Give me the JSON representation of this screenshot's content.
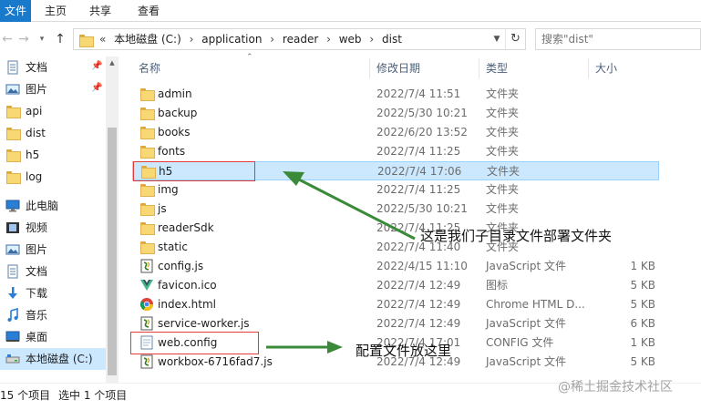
{
  "ribbon": {
    "tabs": [
      "文件",
      "主页",
      "共享",
      "查看"
    ]
  },
  "navigation": {
    "back_icon": "arrow-left-icon",
    "forward_icon": "arrow-right-icon",
    "history_icon": "chevron-down-icon",
    "up_icon": "arrow-up-icon",
    "breadcrumb_overflow": "«",
    "breadcrumb": [
      "本地磁盘 (C:)",
      "application",
      "reader",
      "web",
      "dist"
    ],
    "separator": "›"
  },
  "search": {
    "placeholder": "搜索\"dist\""
  },
  "sidebar": {
    "items": [
      {
        "label": "文档",
        "icon": "documents-icon",
        "pinned": true
      },
      {
        "label": "图片",
        "icon": "pictures-icon",
        "pinned": true
      },
      {
        "label": "api",
        "icon": "folder-icon",
        "pinned": false
      },
      {
        "label": "dist",
        "icon": "folder-icon",
        "pinned": false
      },
      {
        "label": "h5",
        "icon": "folder-icon",
        "pinned": false
      },
      {
        "label": "log",
        "icon": "folder-icon",
        "pinned": false
      },
      {
        "label": "此电脑",
        "icon": "computer-icon",
        "pinned": false
      },
      {
        "label": "视频",
        "icon": "videos-icon",
        "pinned": false
      },
      {
        "label": "图片",
        "icon": "pictures-icon",
        "pinned": false
      },
      {
        "label": "文档",
        "icon": "documents-icon",
        "pinned": false
      },
      {
        "label": "下载",
        "icon": "downloads-icon",
        "pinned": false
      },
      {
        "label": "音乐",
        "icon": "music-icon",
        "pinned": false
      },
      {
        "label": "桌面",
        "icon": "desktop-icon",
        "pinned": false
      },
      {
        "label": "本地磁盘 (C:)",
        "icon": "drive-icon",
        "pinned": false,
        "selected": true
      }
    ]
  },
  "columns": {
    "name": "名称",
    "date": "修改日期",
    "type": "类型",
    "size": "大小"
  },
  "files": [
    {
      "name": "admin",
      "date": "2022/7/4 11:51",
      "type": "文件夹",
      "size": "",
      "icon": "folder-icon"
    },
    {
      "name": "backup",
      "date": "2022/5/30 10:21",
      "type": "文件夹",
      "size": "",
      "icon": "folder-icon"
    },
    {
      "name": "books",
      "date": "2022/6/20 13:52",
      "type": "文件夹",
      "size": "",
      "icon": "folder-icon"
    },
    {
      "name": "fonts",
      "date": "2022/7/4 11:25",
      "type": "文件夹",
      "size": "",
      "icon": "folder-icon"
    },
    {
      "name": "h5",
      "date": "2022/7/4 17:06",
      "type": "文件夹",
      "size": "",
      "icon": "folder-icon",
      "selected": true
    },
    {
      "name": "img",
      "date": "2022/7/4 11:25",
      "type": "文件夹",
      "size": "",
      "icon": "folder-icon"
    },
    {
      "name": "js",
      "date": "2022/5/30 10:21",
      "type": "文件夹",
      "size": "",
      "icon": "folder-icon"
    },
    {
      "name": "readerSdk",
      "date": "2022/7/4 11:25",
      "type": "文件夹",
      "size": "",
      "icon": "folder-icon"
    },
    {
      "name": "static",
      "date": "2022/7/4 11:40",
      "type": "文件夹",
      "size": "",
      "icon": "folder-icon"
    },
    {
      "name": "config.js",
      "date": "2022/4/15 11:10",
      "type": "JavaScript 文件",
      "size": "1 KB",
      "icon": "javascript-file-icon"
    },
    {
      "name": "favicon.ico",
      "date": "2022/7/4 12:49",
      "type": "图标",
      "size": "5 KB",
      "icon": "vue-icon"
    },
    {
      "name": "index.html",
      "date": "2022/7/4 12:49",
      "type": "Chrome HTML D...",
      "size": "5 KB",
      "icon": "chrome-icon"
    },
    {
      "name": "service-worker.js",
      "date": "2022/7/4 12:49",
      "type": "JavaScript 文件",
      "size": "6 KB",
      "icon": "javascript-file-icon"
    },
    {
      "name": "web.config",
      "date": "2022/7/4 17:01",
      "type": "CONFIG 文件",
      "size": "1 KB",
      "icon": "config-file-icon"
    },
    {
      "name": "workbox-6716fad7.js",
      "date": "2022/7/4 12:49",
      "type": "JavaScript 文件",
      "size": "5 KB",
      "icon": "javascript-file-icon"
    }
  ],
  "status": {
    "count": "15 个项目",
    "selected": "选中 1 个项目"
  },
  "annotations": {
    "h5_note": "这是我们子目录文件部署文件夹",
    "config_note": "配置文件放这里",
    "watermark": "@稀土掘金技术社区",
    "highlight_color": "#e03a3a",
    "arrow_color": "#3a8a3a"
  }
}
